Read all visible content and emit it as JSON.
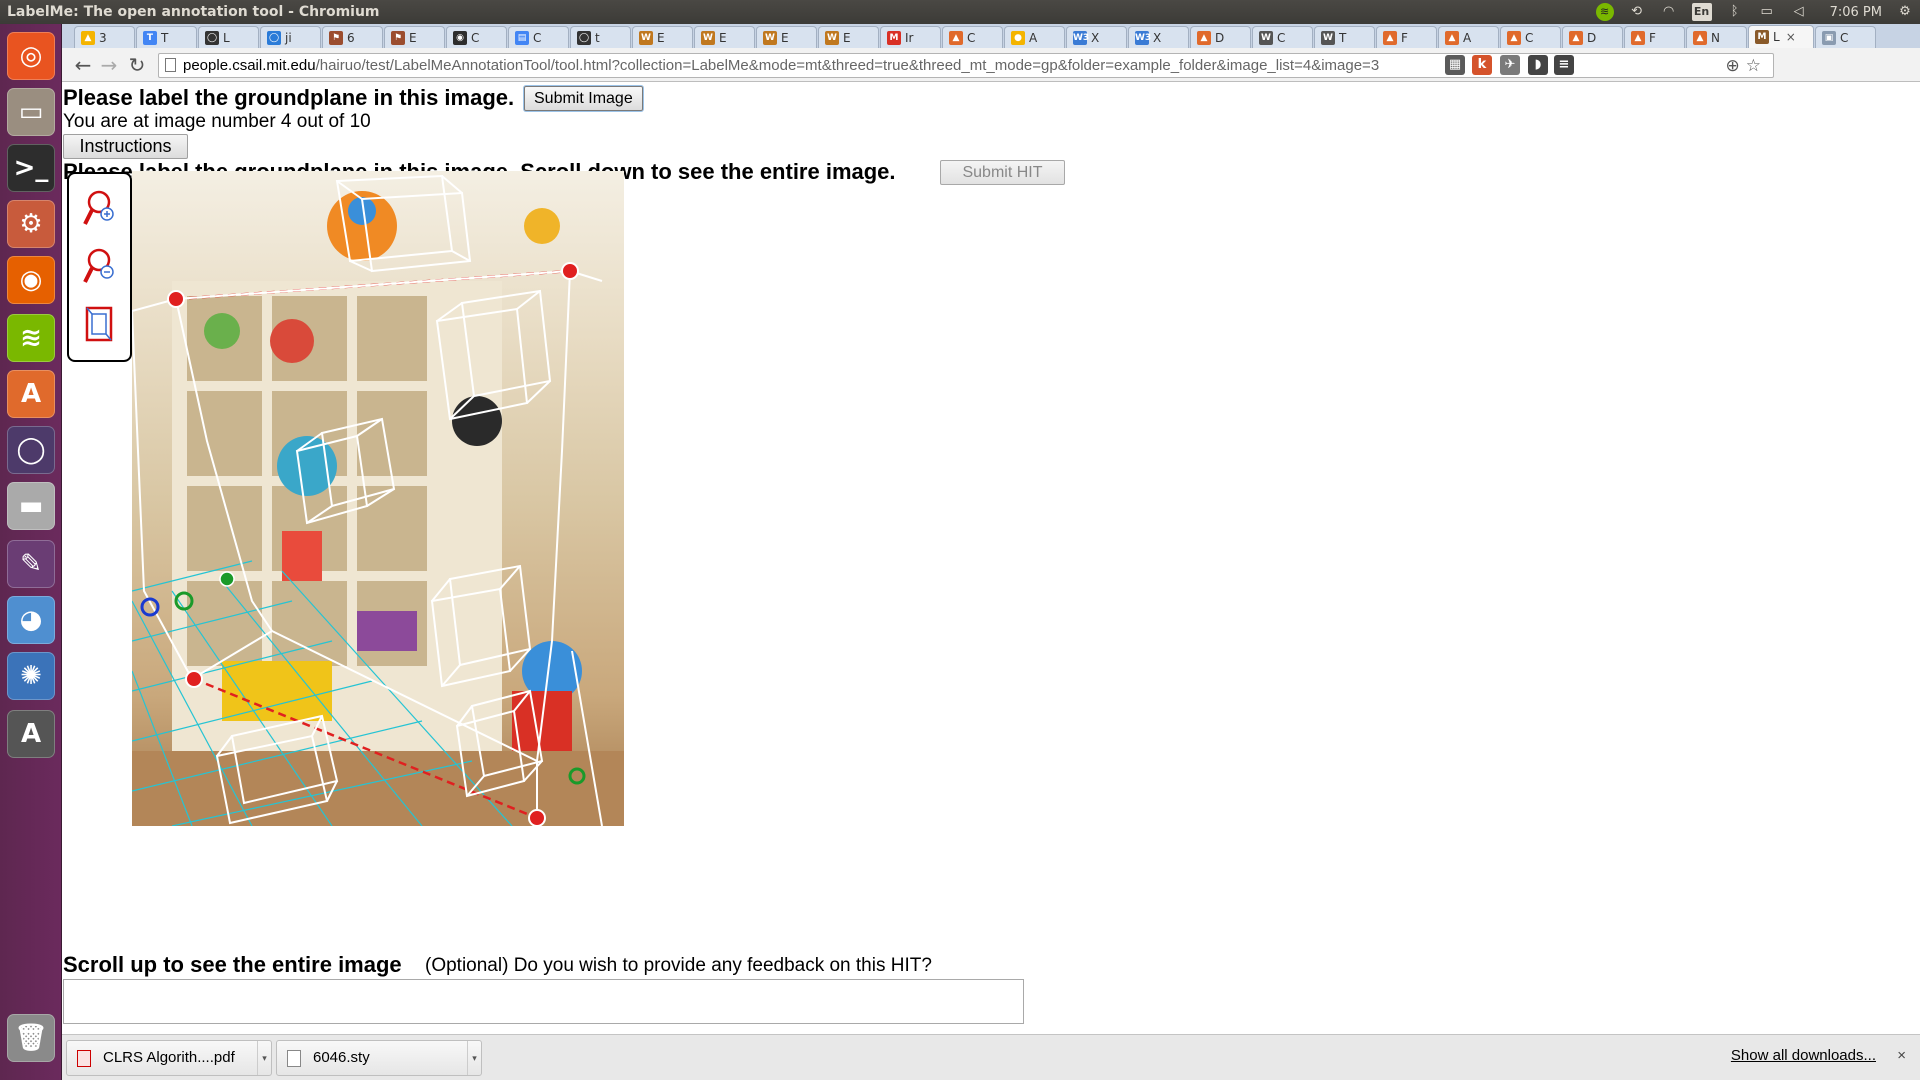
{
  "window": {
    "title": "LabelMe: The open annotation tool - Chromium"
  },
  "tray": {
    "lang": "En",
    "clock": "7:06 PM"
  },
  "launcher": {
    "items": [
      {
        "name": "ubuntu-dash-icon",
        "glyph": "◎",
        "color": "#e95420"
      },
      {
        "name": "files-icon",
        "glyph": "▭",
        "color": "#9a8e80"
      },
      {
        "name": "terminal-icon",
        "glyph": ">_",
        "color": "#2d2d2d"
      },
      {
        "name": "system-settings-icon",
        "glyph": "⚙",
        "color": "#c85b3c"
      },
      {
        "name": "firefox-icon",
        "glyph": "◉",
        "color": "#e66000"
      },
      {
        "name": "spotify-icon",
        "glyph": "≋",
        "color": "#7ab800"
      },
      {
        "name": "software-center-icon",
        "glyph": "A",
        "color": "#e06a2c"
      },
      {
        "name": "app-circle-icon",
        "glyph": "◯",
        "color": "#4d3a6a"
      },
      {
        "name": "drive-icon",
        "glyph": "▬",
        "color": "#aaaaaa"
      },
      {
        "name": "editor-icon",
        "glyph": "✎",
        "color": "#6a3d74"
      },
      {
        "name": "chromium-icon",
        "glyph": "◕",
        "color": "#4f8fd0"
      },
      {
        "name": "shotwell-icon",
        "glyph": "✺",
        "color": "#3b73b9"
      },
      {
        "name": "software-updater-icon",
        "glyph": "A",
        "color": "#555555"
      },
      {
        "name": "trash-icon",
        "glyph": "🗑",
        "color": "#8a8a8a"
      }
    ]
  },
  "tabs": [
    {
      "fav": "▲",
      "color": "#f4b400",
      "label": "3"
    },
    {
      "fav": "T",
      "color": "#4285f4",
      "label": "T"
    },
    {
      "fav": "◯",
      "color": "#333333",
      "label": "L"
    },
    {
      "fav": "◯",
      "color": "#2a7bd8",
      "label": "ji"
    },
    {
      "fav": "⚑",
      "color": "#9b4d2f",
      "label": "6"
    },
    {
      "fav": "⚑",
      "color": "#9b4d2f",
      "label": "E"
    },
    {
      "fav": "◉",
      "color": "#2d2d2d",
      "label": "C"
    },
    {
      "fav": "▤",
      "color": "#4285f4",
      "label": "C"
    },
    {
      "fav": "◯",
      "color": "#333333",
      "label": "t"
    },
    {
      "fav": "W",
      "color": "#c0781f",
      "label": "E"
    },
    {
      "fav": "W",
      "color": "#c0781f",
      "label": "E"
    },
    {
      "fav": "W",
      "color": "#c0781f",
      "label": "E"
    },
    {
      "fav": "W",
      "color": "#c0781f",
      "label": "E"
    },
    {
      "fav": "M",
      "color": "#d93025",
      "label": "Ir"
    },
    {
      "fav": "▲",
      "color": "#e06a2c",
      "label": "C"
    },
    {
      "fav": "●",
      "color": "#f4b400",
      "label": "A"
    },
    {
      "fav": "W3",
      "color": "#3a7bd5",
      "label": "X"
    },
    {
      "fav": "W3",
      "color": "#3a7bd5",
      "label": "X"
    },
    {
      "fav": "▲",
      "color": "#e06a2c",
      "label": "D"
    },
    {
      "fav": "W",
      "color": "#555555",
      "label": "C"
    },
    {
      "fav": "W",
      "color": "#555555",
      "label": "T"
    },
    {
      "fav": "▲",
      "color": "#e06a2c",
      "label": "F"
    },
    {
      "fav": "▲",
      "color": "#e06a2c",
      "label": "A"
    },
    {
      "fav": "▲",
      "color": "#e06a2c",
      "label": "C"
    },
    {
      "fav": "▲",
      "color": "#e06a2c",
      "label": "D"
    },
    {
      "fav": "▲",
      "color": "#e06a2c",
      "label": "F"
    },
    {
      "fav": "▲",
      "color": "#e06a2c",
      "label": "N"
    },
    {
      "fav": "M",
      "color": "#8a5a2a",
      "label": "L",
      "active": true
    },
    {
      "fav": "▣",
      "color": "#8a9bb0",
      "label": "C"
    }
  ],
  "toolbar": {
    "url_host": "people.csail.mit.edu",
    "url_path": "/hairuo/test/LabelMeAnnotationTool/tool.html?collection=LabelMe&mode=mt&threed=true&threed_mt_mode=gp&folder=example_folder&image_list=4&image=3",
    "extensions": [
      {
        "name": "extension-icon-1",
        "glyph": "▦",
        "color": "#5a5a5a"
      },
      {
        "name": "extension-k-icon",
        "glyph": "k",
        "color": "#d5532b"
      },
      {
        "name": "extension-badge-icon",
        "glyph": "✈",
        "color": "#7a7a7a"
      },
      {
        "name": "pocket-icon",
        "glyph": "◗",
        "color": "#444444"
      },
      {
        "name": "menu-icon",
        "glyph": "≡",
        "color": "#444444"
      }
    ]
  },
  "page": {
    "heading": "Please label the groundplane in this image.",
    "submit_image": "Submit Image",
    "counter": "You are at image number 4 out of 10",
    "instructions": "Instructions",
    "scroll_down": "Please label the groundplane in this image. Scroll down to see the entire image.",
    "submit_hit": "Submit HIT",
    "scroll_up": "Scroll up to see the entire image",
    "feedback_label": "(Optional) Do you wish to provide any feedback on this HIT?"
  },
  "downloads": {
    "items": [
      {
        "name": "CLRS Algorith....pdf",
        "type": "pdf"
      },
      {
        "name": "6046.sty",
        "type": "file"
      }
    ],
    "show_all": "Show all downloads...",
    "close": "×"
  }
}
